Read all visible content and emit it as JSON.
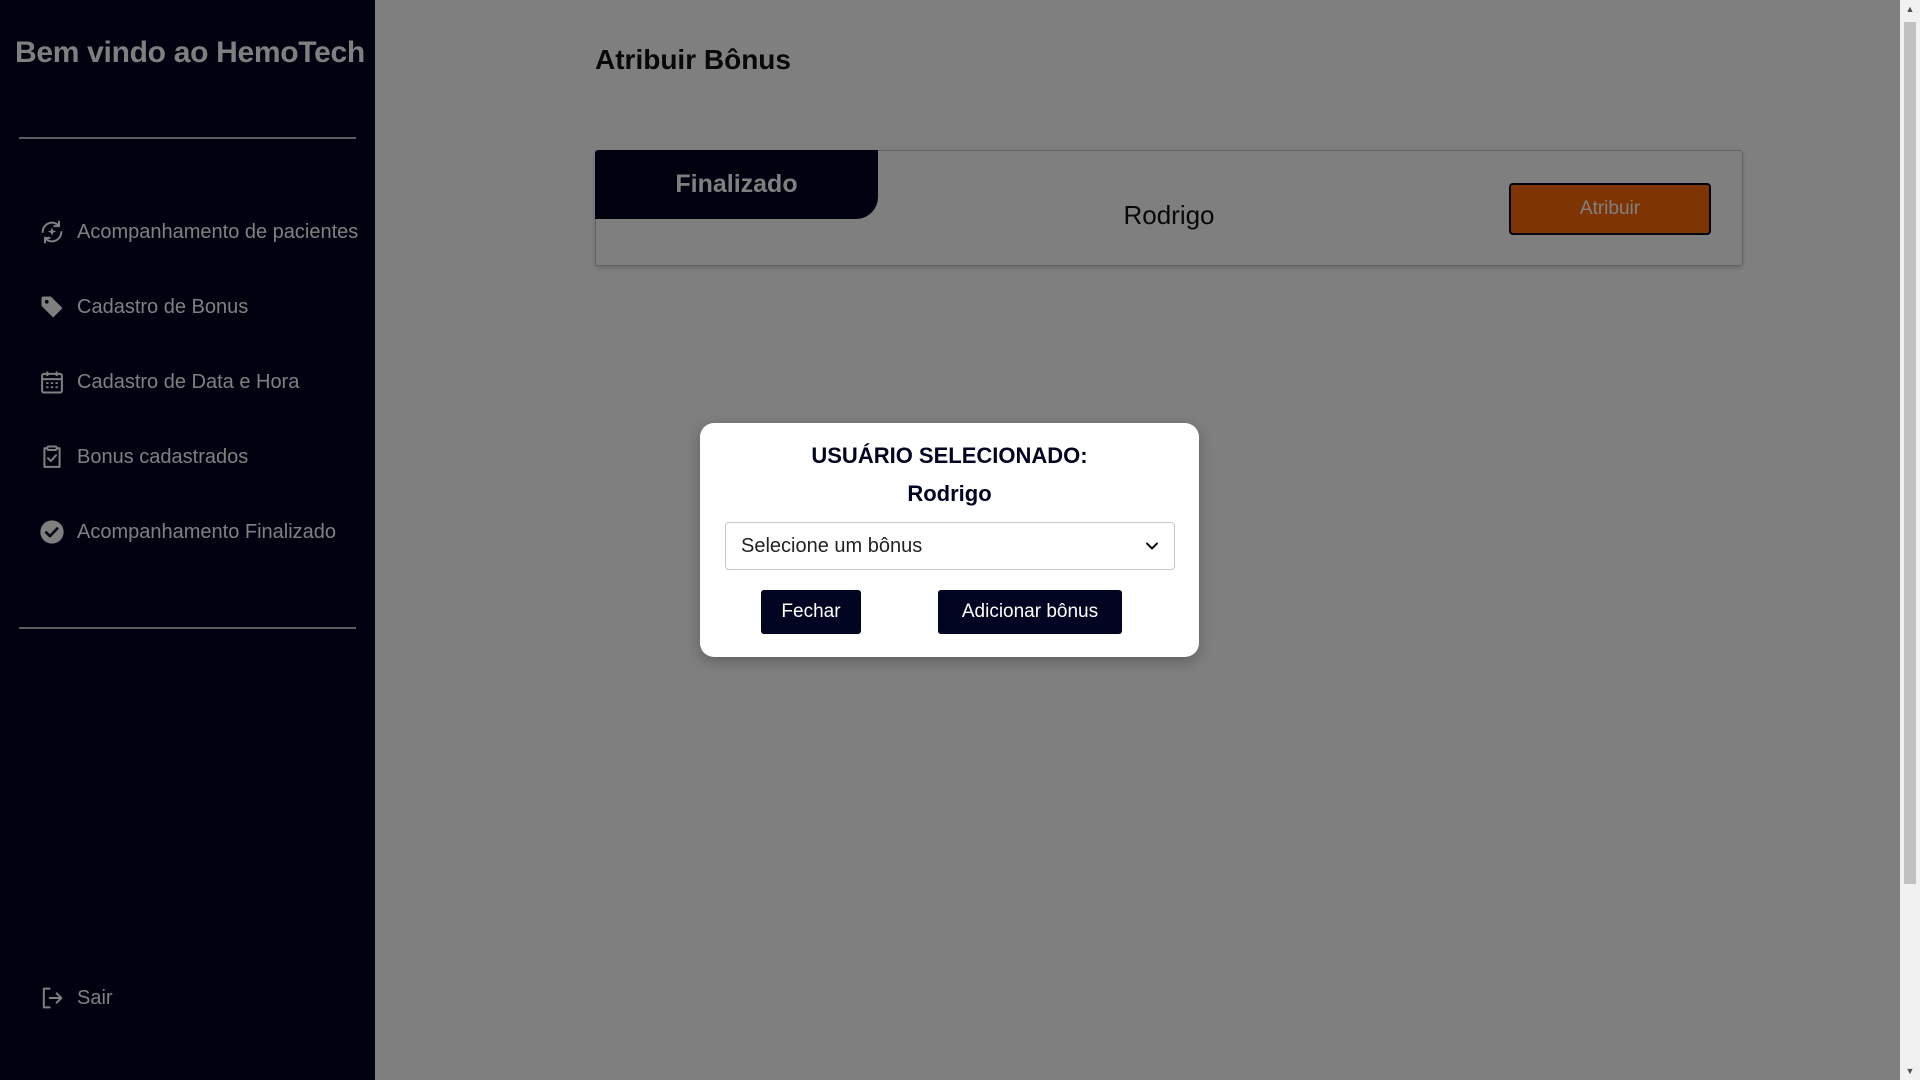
{
  "sidebar": {
    "title": "Bem vindo ao HemoTech",
    "items": [
      {
        "label": "Acompanhamento de pacientes",
        "icon": "patient-monitoring-icon"
      },
      {
        "label": "Cadastro de Bonus",
        "icon": "tag-icon"
      },
      {
        "label": "Cadastro de Data e Hora",
        "icon": "calendar-icon"
      },
      {
        "label": "Bonus cadastrados",
        "icon": "clipboard-check-icon"
      },
      {
        "label": "Acompanhamento Finalizado",
        "icon": "check-circle-icon"
      }
    ],
    "logout": {
      "label": "Sair",
      "icon": "logout-icon"
    }
  },
  "main": {
    "title": "Atribuir Bônus",
    "card": {
      "status": "Finalizado",
      "name": "Rodrigo",
      "button_label": "Atribuir"
    }
  },
  "modal": {
    "title": "USUÁRIO SELECIONADO:",
    "user": "Rodrigo",
    "select_value": "Selecione um bônus",
    "close_label": "Fechar",
    "add_label": "Adicionar bônus"
  },
  "colors": {
    "sidebar_bg": "#010521",
    "accent": "#fd6a06",
    "button_bg": "#010521",
    "overlay": "rgba(0,0,0,0.5)"
  }
}
